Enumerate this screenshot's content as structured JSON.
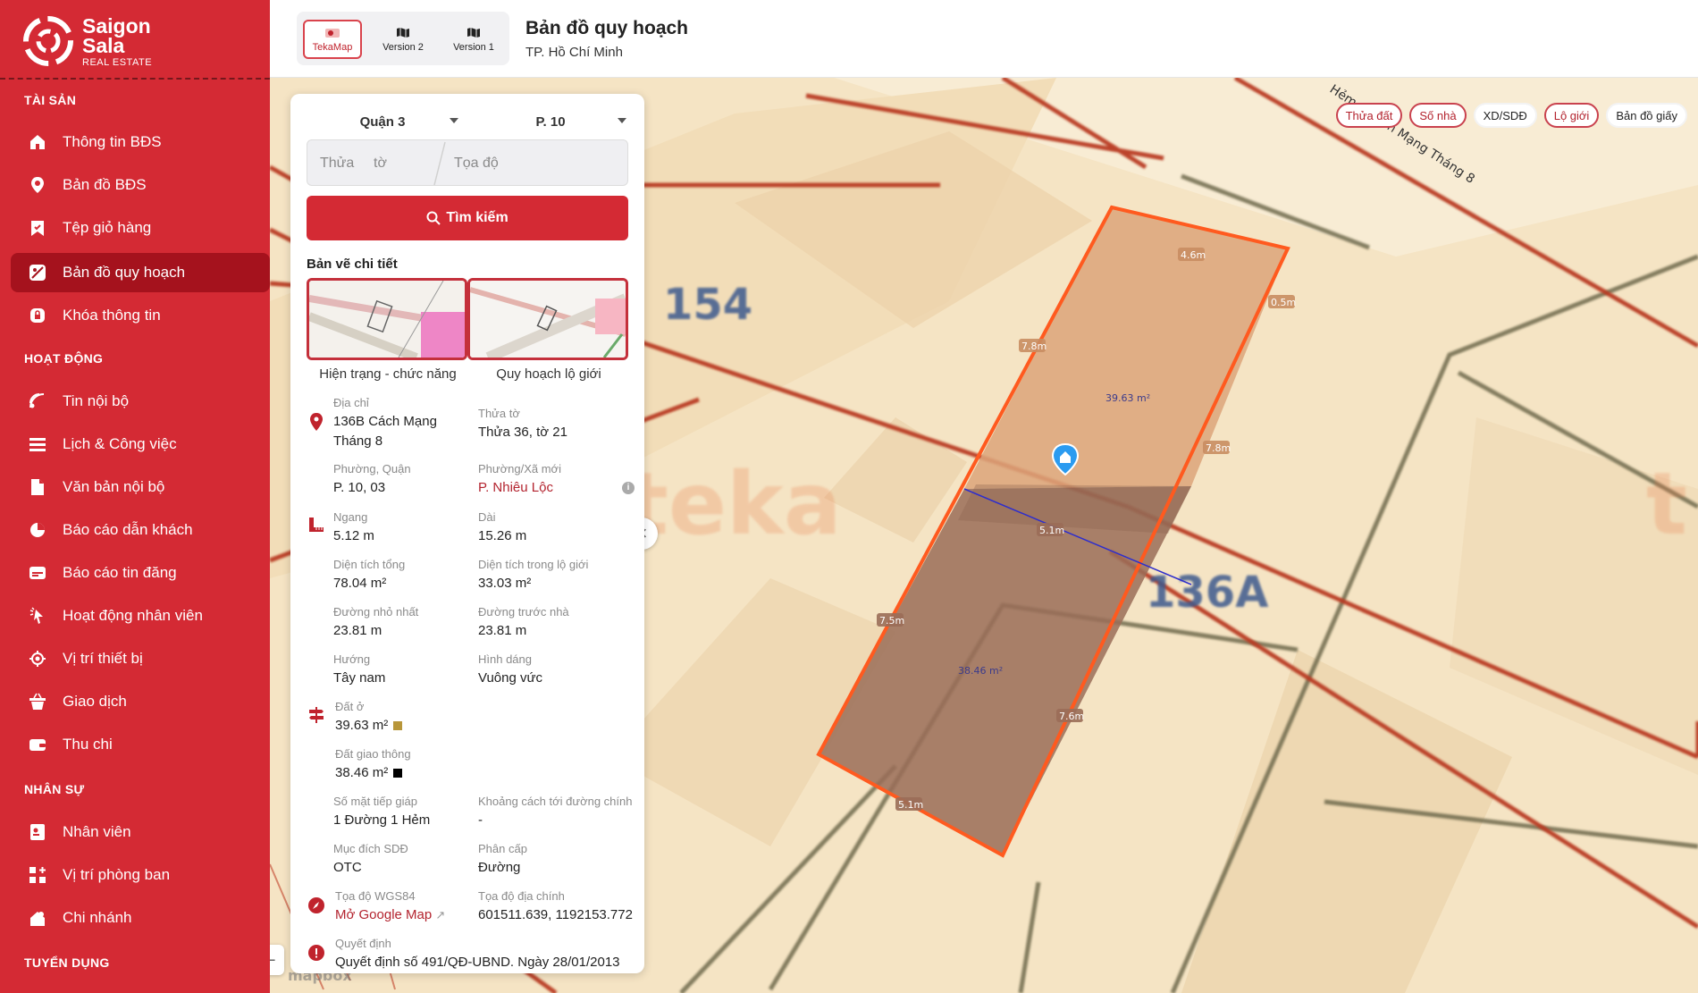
{
  "brand": {
    "name_line1": "Saigon",
    "name_line2": "Sala",
    "tagline": "REAL ESTATE",
    "color": "#d42a34"
  },
  "sidebar": {
    "sections": [
      {
        "title": "TÀI SẢN",
        "items": [
          {
            "label": "Thông tin BĐS",
            "icon": "house-icon"
          },
          {
            "label": "Bản đồ BĐS",
            "icon": "map-pin-icon"
          },
          {
            "label": "Tệp giỏ hàng",
            "icon": "bookmark-icon"
          },
          {
            "label": "Bản đồ quy hoạch",
            "icon": "map-planning-icon",
            "active": true
          },
          {
            "label": "Khóa thông tin",
            "icon": "lock-icon"
          }
        ]
      },
      {
        "title": "HOẠT ĐỘNG",
        "items": [
          {
            "label": "Tin nội bộ",
            "icon": "broadcast-icon"
          },
          {
            "label": "Lịch & Công việc",
            "icon": "list-icon"
          },
          {
            "label": "Văn bản nội bộ",
            "icon": "document-icon"
          },
          {
            "label": "Báo cáo dẫn khách",
            "icon": "pie-chart-icon"
          },
          {
            "label": "Báo cáo tin đăng",
            "icon": "card-icon"
          },
          {
            "label": "Hoạt động nhân viên",
            "icon": "activity-icon"
          },
          {
            "label": "Vị trí thiết bị",
            "icon": "locate-icon"
          },
          {
            "label": "Giao dịch",
            "icon": "basket-icon"
          },
          {
            "label": "Thu chi",
            "icon": "wallet-icon"
          }
        ]
      },
      {
        "title": "NHÂN SỰ",
        "items": [
          {
            "label": "Nhân viên",
            "icon": "id-card-icon"
          },
          {
            "label": "Vị trí phòng ban",
            "icon": "grid-plus-icon"
          },
          {
            "label": "Chi nhánh",
            "icon": "branch-icon"
          }
        ]
      },
      {
        "title": "TUYỂN DỤNG",
        "items": []
      }
    ]
  },
  "topbar": {
    "versions": [
      {
        "label": "TekaMap",
        "active": true
      },
      {
        "label": "Version 2",
        "active": false
      },
      {
        "label": "Version 1",
        "active": false
      }
    ],
    "title": "Bản đồ quy hoạch",
    "subtitle": "TP. Hồ Chí Minh"
  },
  "map": {
    "layers": [
      {
        "label": "Thửa đất",
        "on": true
      },
      {
        "label": "Số nhà",
        "on": true
      },
      {
        "label": "XD/SDĐ",
        "on": false
      },
      {
        "label": "Lộ giới",
        "on": true
      },
      {
        "label": "Bản đồ giấy",
        "on": false
      }
    ],
    "street_label": "Hẻm 1 Cách Mạng Tháng 8",
    "house_numbers": [
      "154",
      "136A"
    ],
    "watermark": "teka",
    "attribution": "mapbox",
    "edge_labels": [
      "4.6m",
      "0.5m",
      "7.8m",
      "7.8m",
      "5.1m",
      "7.5m",
      "7.6m",
      "5.1m"
    ],
    "area_labels": [
      "39.63 m²",
      "38.46 m²"
    ],
    "colors": {
      "background": "#f7e6c6",
      "road_boundary": "#b93a24",
      "parcel_outline": "#ff5a1f",
      "residential": "#d8a072",
      "transport": "#9a6d58"
    }
  },
  "panel": {
    "district": "Quận 3",
    "ward": "P. 10",
    "parcel_placeholder": "Thửa",
    "sheet_placeholder": "tờ",
    "coord_placeholder": "Tọa độ",
    "search_label": "Tìm kiếm",
    "drawings_title": "Bản vẽ chi tiết",
    "drawings": [
      "Hiện trạng - chức năng",
      "Quy hoạch lộ giới"
    ],
    "fields": {
      "address_label": "Địa chỉ",
      "address_line1": "136B Cách Mạng",
      "address_line2": "Tháng 8",
      "parcel_label": "Thửa tờ",
      "parcel": "Thửa 36, tờ 21",
      "ward_label": "Phường, Quận",
      "ward": "P. 10, 03",
      "new_ward_label": "Phường/Xã mới",
      "new_ward": "P. Nhiêu Lộc",
      "width_label": "Ngang",
      "width": "5.12 m",
      "length_label": "Dài",
      "length": "15.26 m",
      "total_area_label": "Diện tích tổng",
      "total_area": "78.04 m²",
      "row_area_label": "Diện tích trong lộ giới",
      "row_area": "33.03 m²",
      "min_road_label": "Đường nhỏ nhất",
      "min_road": "23.81 m",
      "front_road_label": "Đường trước nhà",
      "front_road": "23.81 m",
      "direction_label": "Hướng",
      "direction": "Tây nam",
      "shape_label": "Hình dáng",
      "shape": "Vuông vức",
      "land1_label": "Đất ở",
      "land1": "39.63 m²",
      "land1_color": "#b8963a",
      "land2_label": "Đất giao thông",
      "land2": "38.46 m²",
      "land2_color": "#000000",
      "frontage_label": "Số mặt tiếp giáp",
      "frontage": "1 Đường 1 Hẻm",
      "main_road_dist_label": "Khoảng cách tới đường chính",
      "main_road_dist": "-",
      "usage_label": "Mục đích SDĐ",
      "usage": "OTC",
      "class_label": "Phân cấp",
      "class": "Đường",
      "wgs_label": "Tọa độ WGS84",
      "wgs_link": "Mở Google Map",
      "cadastral_label": "Tọa độ địa chính",
      "cadastral": "601511.639, 1192153.772",
      "decision_label": "Quyết định",
      "decision": "Quyết định số 491/QĐ-UBND. Ngày 28/01/2013"
    }
  }
}
